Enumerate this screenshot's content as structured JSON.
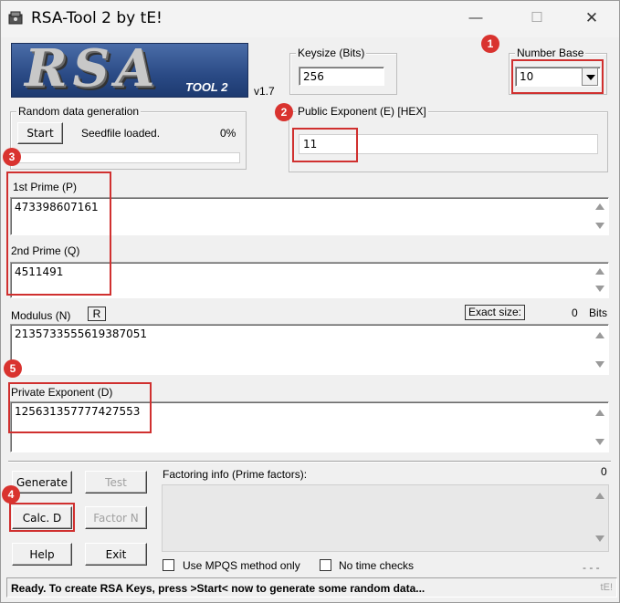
{
  "window": {
    "title": "RSA-Tool 2 by tE!",
    "minimize": "—",
    "maximize": "☐",
    "close": "✕"
  },
  "logo": {
    "main": "RSA",
    "sub": "TOOL 2"
  },
  "version": "v1.7",
  "keysize": {
    "label": "Keysize (Bits)",
    "value": "256"
  },
  "number_base": {
    "label": "Number Base",
    "value": "10"
  },
  "random": {
    "label": "Random data generation",
    "start": "Start",
    "status": "Seedfile loaded.",
    "percent": "0%",
    "progress": 0
  },
  "public_exponent": {
    "label": "Public Exponent (E) [HEX]",
    "value": "11"
  },
  "prime_p": {
    "label": "1st Prime (P)",
    "value": "473398607161"
  },
  "prime_q": {
    "label": "2nd Prime (Q)",
    "value": "4511491"
  },
  "modulus": {
    "label": "Modulus (N)",
    "r_button": "R",
    "exact_label": "Exact size:",
    "exact_value": "0",
    "bits": "Bits",
    "value": "2135733555619387051"
  },
  "private_exponent": {
    "label": "Private Exponent (D)",
    "value": "125631357777427553"
  },
  "buttons": {
    "generate": "Generate",
    "test": "Test",
    "calc_d": "Calc. D",
    "factor_n": "Factor N",
    "help": "Help",
    "exit": "Exit"
  },
  "factoring": {
    "label": "Factoring info (Prime factors):",
    "count": "0",
    "dashes": "- - -"
  },
  "options": {
    "mpqs": "Use MPQS method only",
    "no_time": "No time checks"
  },
  "status": {
    "text": "Ready. To create RSA Keys, press >Start< now to generate some random data...",
    "signature": "tE!"
  },
  "markers": [
    "1",
    "2",
    "3",
    "4",
    "5"
  ],
  "colors": {
    "highlight": "#d0302f",
    "marker": "#d9332f"
  }
}
